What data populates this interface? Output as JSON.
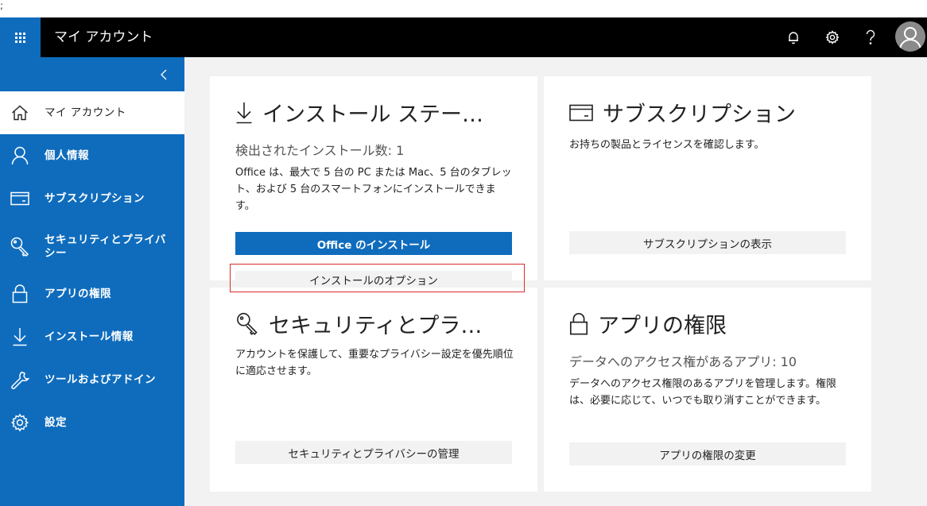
{
  "stray_text": ";",
  "header": {
    "title": "マイ アカウント",
    "icons": [
      "apps-icon",
      "bell-icon",
      "gear-icon",
      "help-icon",
      "avatar"
    ]
  },
  "sidebar": {
    "items": [
      {
        "label": "マイ アカウント",
        "icon": "home-icon",
        "active": true
      },
      {
        "label": "個人情報",
        "icon": "person-icon"
      },
      {
        "label": "サブスクリプション",
        "icon": "card-icon"
      },
      {
        "label": "セキュリティとプライバシー",
        "icon": "key-icon"
      },
      {
        "label": "アプリの権限",
        "icon": "lock-icon"
      },
      {
        "label": "インストール情報",
        "icon": "download-icon"
      },
      {
        "label": "ツールおよびアドイン",
        "icon": "wrench-icon"
      },
      {
        "label": "設定",
        "icon": "gear-icon"
      }
    ]
  },
  "cards": {
    "install": {
      "title": "インストール ステー…",
      "subtitle": "検出されたインストール数: 1",
      "description": "Office は、最大で 5 台の PC または Mac、5 台のタブレット、および 5 台のスマートフォンにインストールできます。",
      "primary_button": "Office のインストール",
      "secondary_button": "インストールのオプション"
    },
    "subscription": {
      "title": "サブスクリプション",
      "description": "お持ちの製品とライセンスを確認します。",
      "button": "サブスクリプションの表示"
    },
    "security": {
      "title": "セキュリティとプラ…",
      "description": "アカウントを保護して、重要なプライバシー設定を優先順位に適応させます。",
      "button": "セキュリティとプライバシーの管理"
    },
    "app_permissions": {
      "title": "アプリの権限",
      "subtitle": "データへのアクセス権があるアプリ: 10",
      "description": "データへのアクセス権限のあるアプリを管理します。権限は、必要に応じて、いつでも取り消すことができます。",
      "button": "アプリの権限の変更"
    }
  },
  "colors": {
    "brand": "#0f6cbd",
    "topbar": "#000000",
    "highlight": "#d92b2b"
  }
}
